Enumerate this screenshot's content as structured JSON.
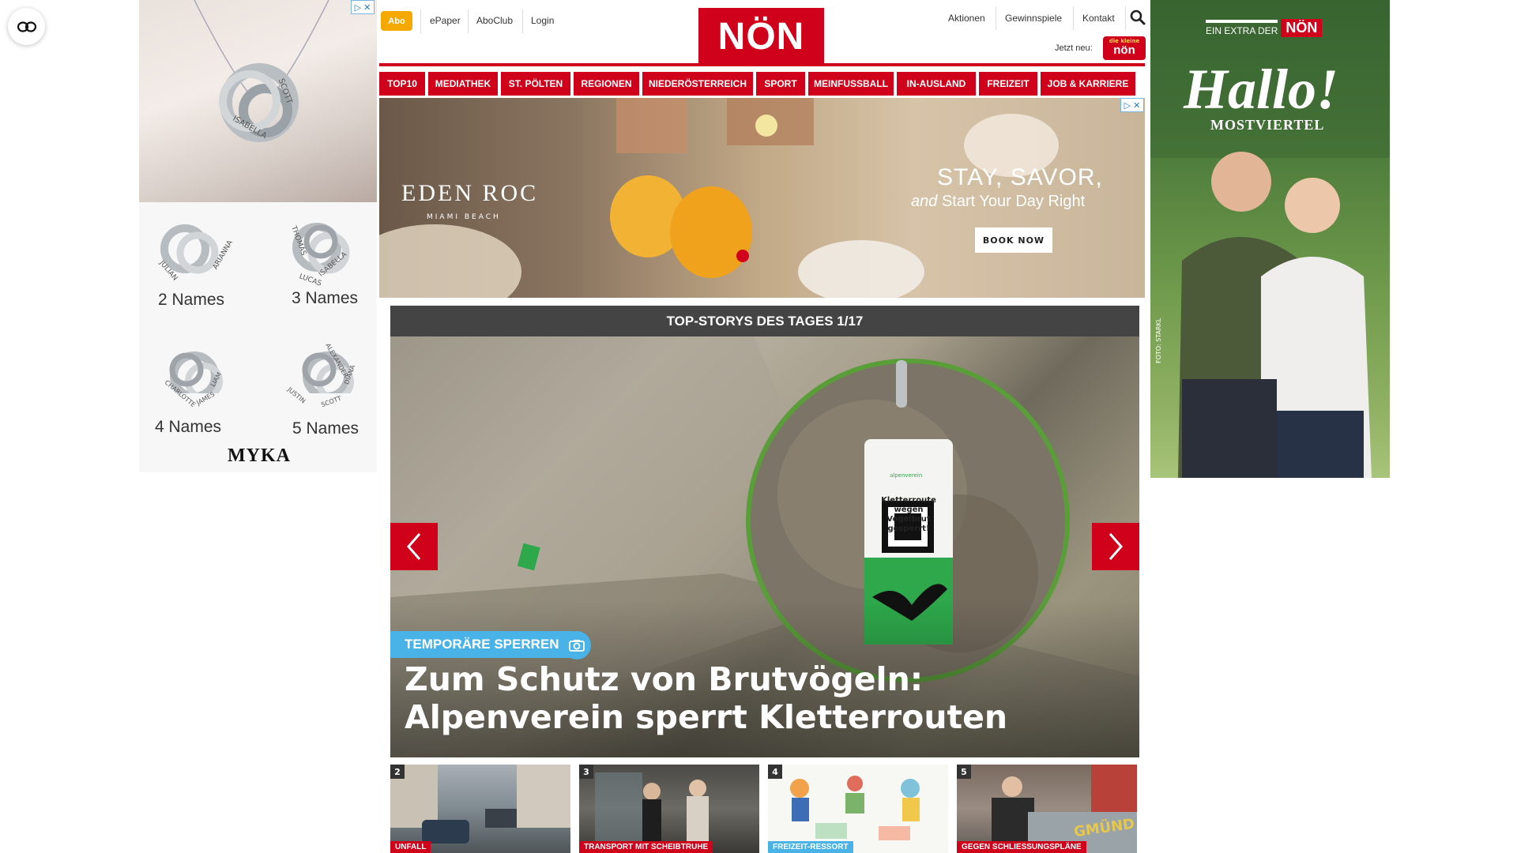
{
  "reader": {
    "icon": "reader-mode-icon"
  },
  "ad_left": {
    "captions": [
      "2 Names",
      "3 Names",
      "4 Names",
      "5 Names"
    ],
    "brand": "MYKA",
    "pendant_names": [
      "ISABELLA",
      "SCOTT",
      "JULIAN",
      "ARIANNA",
      "THOMAS",
      "ISABELLA",
      "LUCAS",
      "CHARLOTTE",
      "JAMES",
      "LIAM",
      "JUSTIN",
      "SCOTT",
      "DIANA",
      "ALEXANDER"
    ]
  },
  "header": {
    "abo": "Abo",
    "epaper": "ePaper",
    "aboclub": "AboClub",
    "login": "Login",
    "logo": "NÖN",
    "aktionen": "Aktionen",
    "gewinnspiele": "Gewinnspiele",
    "kontakt": "Kontakt",
    "jetzt_neu": "Jetzt neu:",
    "kleine_badge_top": "die kleine",
    "kleine_badge_bottom": "nön"
  },
  "nav": [
    "TOP10",
    "MEDIATHEK",
    "ST. PÖLTEN",
    "REGIONEN",
    "NIEDERÖSTERREICH",
    "SPORT",
    "MEINFUSSBALL",
    "IN-AUSLAND",
    "FREIZEIT",
    "JOB & KARRIERE"
  ],
  "banner": {
    "brand": "EDEN ROC",
    "brand_sub": "MIAMI BEACH",
    "headline1": "STAY, SAVOR,",
    "headline2_em": "and",
    "headline2": "Start Your Day Right",
    "cta": "BOOK NOW"
  },
  "slider": {
    "title": "TOP-STORYS DES TAGES 1/17",
    "kicker": "TEMPORÄRE SPERREN",
    "headline": "Zum Schutz von Brutvögeln: Alpenverein sperrt Kletterrouten",
    "sign_text": "Kletterroute wegen Vogelbrut gesperrt!",
    "sign_brand": "alpenverein"
  },
  "thumbs": [
    {
      "num": "2",
      "cat": "UNFALL"
    },
    {
      "num": "3",
      "cat": "TRANSPORT MIT SCHEIBTRUHE"
    },
    {
      "num": "4",
      "cat": "FREIZEIT-RESSORT"
    },
    {
      "num": "5",
      "cat": "GEGEN SCHLIESSUNGSPLÄNE",
      "sign": "GMÜND"
    }
  ],
  "ad_right": {
    "tag_prefix": "EIN EXTRA DER",
    "tag_logo": "NÖN",
    "title": "Hallo!",
    "subtitle": "MOSTVIERTEL",
    "credit": "FOTO: STARKL"
  },
  "colors": {
    "brand_red": "#d0021b",
    "abo_yellow": "#f5a800",
    "kicker_blue": "#49b3e8"
  }
}
